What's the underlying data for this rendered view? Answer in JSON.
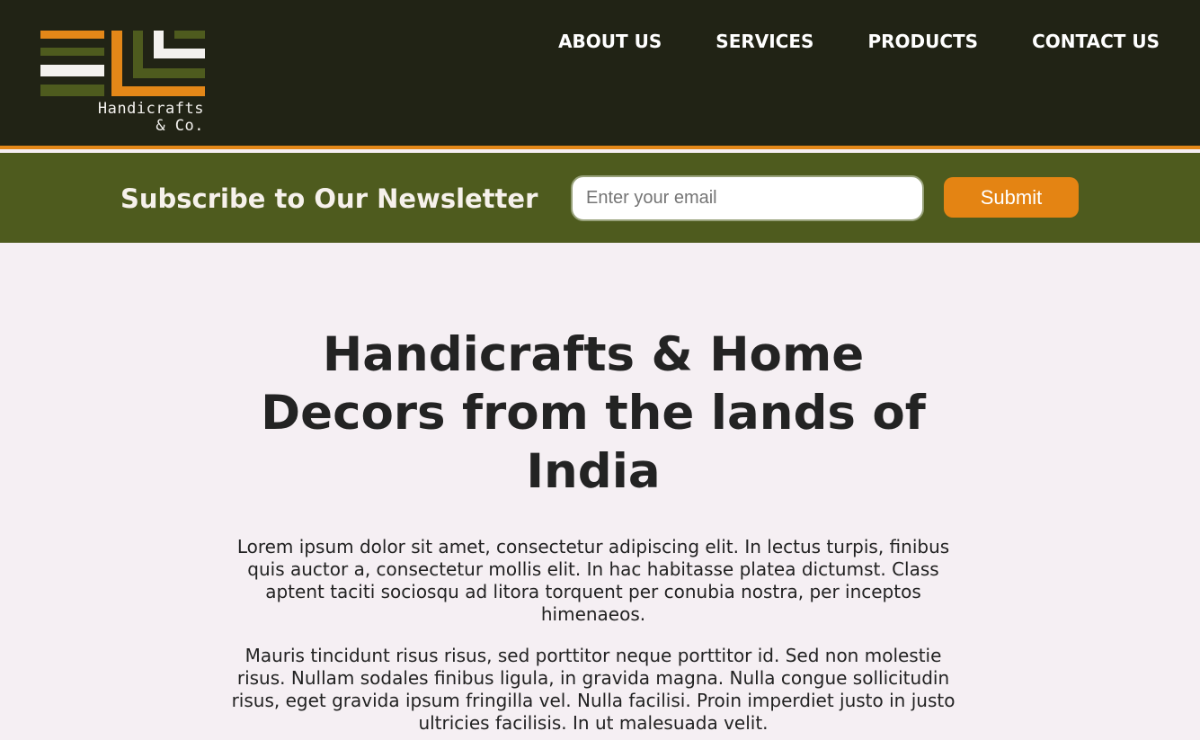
{
  "brand": {
    "name_line1": "Handicrafts",
    "name_line2": "& Co.",
    "colors": {
      "orange": "#e38718",
      "olive": "#4e5b1e",
      "off_white": "#f3f1ee",
      "header_bg": "#212315"
    }
  },
  "nav": {
    "items": [
      {
        "label": "ABOUT US"
      },
      {
        "label": "SERVICES"
      },
      {
        "label": "PRODUCTS"
      },
      {
        "label": "CONTACT US"
      }
    ]
  },
  "newsletter": {
    "title": "Subscribe to Our Newsletter",
    "email_placeholder": "Enter your email",
    "email_value": "",
    "submit_label": "Submit"
  },
  "hero": {
    "heading": "Handicrafts & Home Decors from the lands of India",
    "paragraphs": [
      "Lorem ipsum dolor sit amet, consectetur adipiscing elit. In lectus turpis, finibus quis auctor a, consectetur mollis elit. In hac habitasse platea dictumst. Class aptent taciti sociosqu ad litora torquent per conubia nostra, per inceptos himenaeos.",
      "Mauris tincidunt risus risus, sed porttitor neque porttitor id. Sed non molestie risus. Nullam sodales finibus ligula, in gravida magna. Nulla congue sollicitudin risus, eget gravida ipsum fringilla vel. Nulla facilisi. Proin imperdiet justo in justo ultricies facilisis. In ut malesuada velit."
    ]
  }
}
